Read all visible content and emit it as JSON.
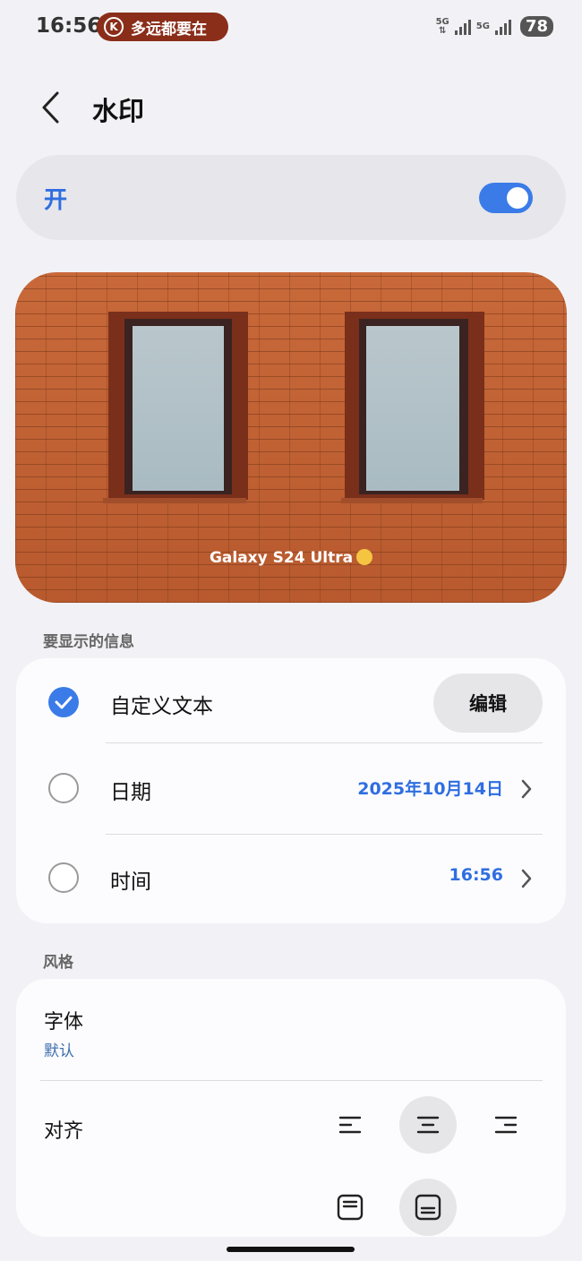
{
  "status_bar": {
    "time": "16:56",
    "notification_pill_text": "多远都要在",
    "notification_icon_letter": "K",
    "network_label_1": "5G",
    "network_label_2": "5G",
    "battery": "78"
  },
  "header": {
    "title": "水印"
  },
  "master_toggle": {
    "label": "开",
    "state": "on"
  },
  "preview": {
    "watermark_text": "Galaxy S24 Ultra"
  },
  "info_section": {
    "label": "要显示的信息",
    "rows": [
      {
        "label": "自定义文本",
        "checked": true,
        "action_label": "编辑"
      },
      {
        "label": "日期",
        "checked": false,
        "value": "2025年10月14日"
      },
      {
        "label": "时间",
        "checked": false,
        "value": "16:56"
      }
    ]
  },
  "style_section": {
    "label": "风格",
    "font_label": "字体",
    "font_value": "默认",
    "align_label": "对齐",
    "align_options": [
      "align-left",
      "align-center",
      "align-right"
    ],
    "align_selected": "align-center",
    "position_options": [
      "position-top",
      "position-bottom"
    ],
    "position_selected": "position-bottom"
  },
  "colors": {
    "accent": "#3a7be8",
    "value_blue": "#2f6ee0",
    "background": "#f2f2f6",
    "pill": "#8a2e1a"
  }
}
